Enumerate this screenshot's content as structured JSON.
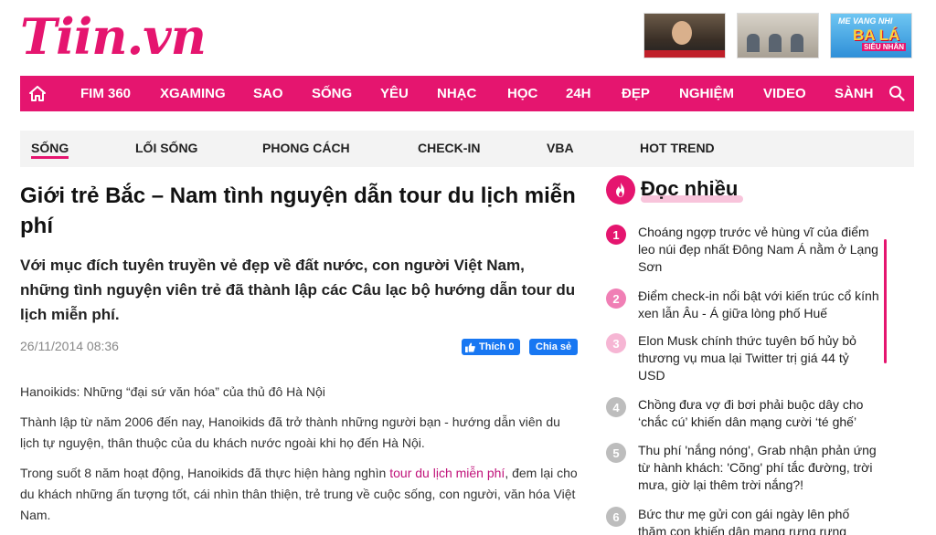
{
  "header": {
    "logo_text": "Tiin.vn",
    "banners": [
      {
        "name": "news-banner-1"
      },
      {
        "name": "news-banner-2"
      },
      {
        "name": "mc-vang-nhi-banner",
        "line1": "ME VANG NHI",
        "line2": "BA LÁ",
        "line3": "SIÊU NHÂN"
      }
    ]
  },
  "main_nav": {
    "home_icon": "home-icon",
    "search_icon": "search-icon",
    "items": [
      "FIM 360",
      "XGAMING",
      "SAO",
      "SỐNG",
      "YÊU",
      "NHẠC",
      "HỌC",
      "24H",
      "ĐẸP",
      "NGHIỆM",
      "VIDEO",
      "SÀNH"
    ]
  },
  "sub_nav": {
    "items": [
      "SỐNG",
      "LỐI SỐNG",
      "PHONG CÁCH",
      "CHECK-IN",
      "VBA",
      "HOT TREND"
    ],
    "active": "SỐNG"
  },
  "article": {
    "title": "Giới trẻ Bắc – Nam tình nguyện dẫn tour du lịch miễn phí",
    "sapo": "Với mục đích tuyên truyền vẻ đẹp về đất nước, con người Việt Nam, những tình nguyện viên trẻ đã thành lập các Câu lạc bộ hướng dẫn tour du lịch miễn phí.",
    "date": "26/11/2014 08:36",
    "like_label": "Thích 0",
    "share_label": "Chia sẻ",
    "paragraphs": {
      "p1": "Hanoikids: Những “đại sứ văn hóa” của thủ đô Hà Nội",
      "p2": "Thành lập từ năm 2006 đến nay, Hanoikids đã trở thành những người bạn - hướng dẫn viên du lịch tự nguyện, thân thuộc của du khách nước ngoài khi họ đến Hà Nội.",
      "p3_before": "Trong suốt 8 năm hoạt động, Hanoikids đã thực hiện hàng nghìn ",
      "p3_link": "tour du lịch miễn phí",
      "p3_after": ", đem lại cho du khách những ấn tượng tốt, cái nhìn thân thiện, trẻ trung về cuộc sống, con người, văn hóa Việt Nam."
    }
  },
  "doc_nhieu": {
    "title": "Đọc nhiều",
    "icon": "fire-icon",
    "items": [
      {
        "num": "1",
        "text": "Choáng ngợp trước vẻ hùng vĩ của điểm leo núi đẹp nhất Đông Nam Á nằm ở Lạng Sơn",
        "color": "#e5156f"
      },
      {
        "num": "2",
        "text": "Điểm check-in nổi bật với kiến trúc cổ kính xen lẫn Âu - Á giữa lòng phố Huế",
        "color": "#f07fb5"
      },
      {
        "num": "3",
        "text": "Elon Musk chính thức tuyên bố hủy bỏ thương vụ mua lại Twitter trị giá 44 tỷ USD",
        "color": "#f6b6d4"
      },
      {
        "num": "4",
        "text": "Chồng đưa vợ đi bơi phải buộc dây cho ‘chắc cú’ khiến dân mạng cười ‘té ghế’",
        "color": "#bdbdbd"
      },
      {
        "num": "5",
        "text": "Thu phí 'nắng nóng', Grab nhận phản ứng từ hành khách: 'Cõng' phí tắc đường, trời mưa, giờ lại thêm trời nắng?!",
        "color": "#bdbdbd"
      },
      {
        "num": "6",
        "text": "Bức thư mẹ gửi con gái ngày lên phố thăm con khiến dân mạng rưng rưng",
        "color": "#bdbdbd"
      }
    ]
  }
}
